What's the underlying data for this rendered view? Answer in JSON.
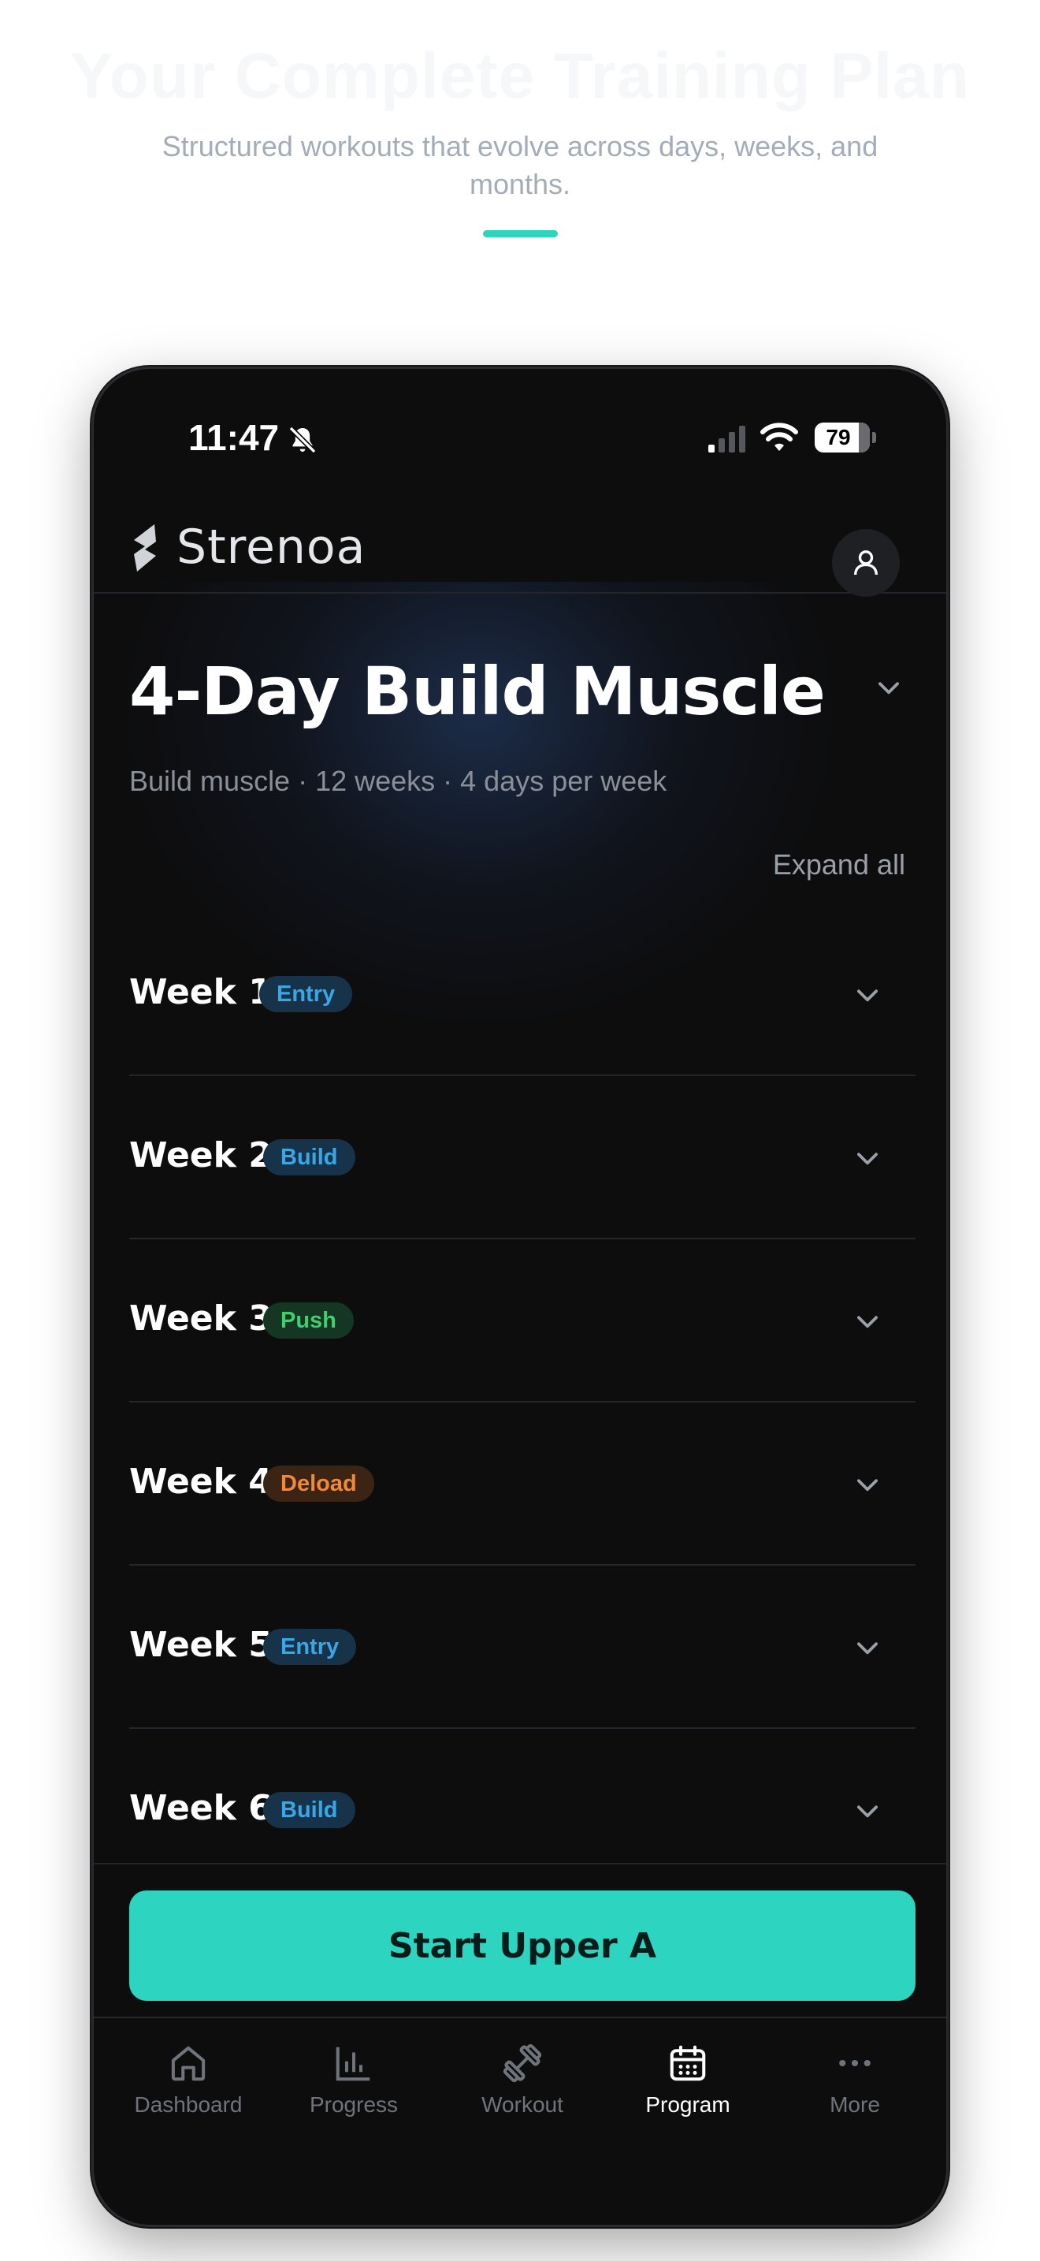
{
  "hero": {
    "title": "Your Complete Training Plan",
    "subtitle": "Structured workouts that evolve across days, weeks, and months.",
    "accent_color": "#2dd4bf"
  },
  "status_bar": {
    "time": "11:47",
    "battery": "79",
    "icons": [
      "bell-slash-icon",
      "signal-icon",
      "wifi-icon",
      "battery-icon"
    ]
  },
  "app": {
    "name": "Strenoa",
    "profile_icon": "user-icon"
  },
  "program": {
    "title": "4-Day Build Muscle",
    "meta": "Build muscle · 12 weeks · 4 days per week",
    "expand_all": "Expand all"
  },
  "weeks": [
    {
      "label": "Week 1",
      "badge": "Entry",
      "badge_color": "#3aa6e6"
    },
    {
      "label": "Week 2",
      "badge": "Build",
      "badge_color": "#3aa6e6"
    },
    {
      "label": "Week 3",
      "badge": "Push",
      "badge_color": "#3fcf6d"
    },
    {
      "label": "Week 4",
      "badge": "Deload",
      "badge_color": "#ee8a3a"
    },
    {
      "label": "Week 5",
      "badge": "Entry",
      "badge_color": "#3aa6e6"
    },
    {
      "label": "Week 6",
      "badge": "Build",
      "badge_color": "#3aa6e6"
    }
  ],
  "cta": {
    "label": "Start Upper A"
  },
  "tabbar": {
    "items": [
      {
        "label": "Dashboard",
        "icon": "home-icon"
      },
      {
        "label": "Progress",
        "icon": "bar-chart-icon"
      },
      {
        "label": "Workout",
        "icon": "dumbbell-icon"
      },
      {
        "label": "Program",
        "icon": "calendar-icon",
        "active": true
      },
      {
        "label": "More",
        "icon": "more-icon"
      }
    ]
  }
}
